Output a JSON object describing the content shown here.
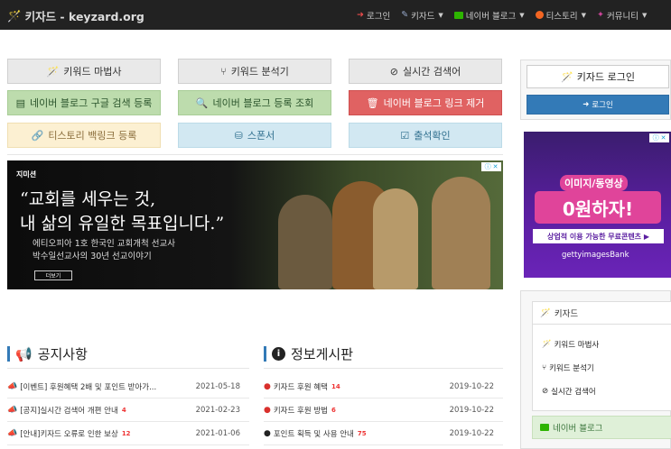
{
  "navbar": {
    "brand": "키자드 - keyzard.org",
    "items": [
      {
        "label": "로그인",
        "icon": "login-icon",
        "has_caret": false
      },
      {
        "label": "키자드",
        "icon": "magic-wand-icon",
        "has_caret": true
      },
      {
        "label": "네이버 블로그",
        "icon": "naver-blog-icon",
        "has_caret": true
      },
      {
        "label": "티스토리",
        "icon": "tistory-icon",
        "has_caret": true
      },
      {
        "label": "커뮤니티",
        "icon": "community-icon",
        "has_caret": true
      }
    ]
  },
  "buttons": [
    {
      "label": "키워드 마법사",
      "style": "default"
    },
    {
      "label": "키워드 분석기",
      "style": "default"
    },
    {
      "label": "실시간 검색어",
      "style": "default"
    },
    {
      "label": "네이버 블로그 구글 검색 등록",
      "style": "success"
    },
    {
      "label": "네이버 블로그 등록 조회",
      "style": "success"
    },
    {
      "label": "네이버 블로그 링크 제거",
      "style": "danger"
    },
    {
      "label": "티스토리 백링크 등록",
      "style": "warning"
    },
    {
      "label": "스폰서",
      "style": "info"
    },
    {
      "label": "출석확인",
      "style": "info"
    }
  ],
  "ad_banner": {
    "logo": "지미션",
    "headline_1": "“교회를 세우는 것,",
    "headline_2": "내 삶의 유일한 목표입니다.”",
    "sub_1": "에티오피아 1호 한국인 교회개척 선교사",
    "sub_2": "박수일선교사의 30년 선교이야기",
    "more": "더보기"
  },
  "notice": {
    "title": "공지사항",
    "rows": [
      {
        "icon": "megaphone-icon",
        "text": "[이벤트] 후원혜택 2배 및 포인트 받아가...",
        "count": "",
        "date": "2021-05-18"
      },
      {
        "icon": "megaphone-icon",
        "text": "[공지]실시간 검색어 개편 안내",
        "count": "4",
        "date": "2021-02-23"
      },
      {
        "icon": "megaphone-icon",
        "text": "[안내]키자드 오류로 인한 보상",
        "count": "12",
        "date": "2021-01-06"
      }
    ]
  },
  "info": {
    "title": "정보게시판",
    "rows": [
      {
        "icon": "info-circle-icon",
        "text": "키자드 후원 혜택",
        "count": "14",
        "date": "2019-10-22"
      },
      {
        "icon": "info-circle-icon",
        "text": "키자드 후원 방법",
        "count": "6",
        "date": "2019-10-22"
      },
      {
        "icon": "info-circle-icon",
        "text": "포인트 획득 및 사용 안내",
        "count": "75",
        "date": "2019-10-22"
      }
    ]
  },
  "sidebar": {
    "login_title": "키자드 로그인",
    "login_button": "로그인",
    "ad": {
      "line1": "이미지/동영상",
      "line2": "0원하자!",
      "line3": "상업적 이용 가능한 무료콘텐츠 ▶",
      "line4": "gettyimagesBank"
    },
    "keyzard_panel": {
      "title": "키자드",
      "items": [
        "키워드 마법사",
        "키워드 분석기",
        "실시간 검색어"
      ]
    },
    "naver_panel": {
      "title": "네이버 블로그"
    }
  },
  "colors": {
    "primary": "#337ab7",
    "danger": "#d9534f",
    "navbar": "#222222"
  }
}
